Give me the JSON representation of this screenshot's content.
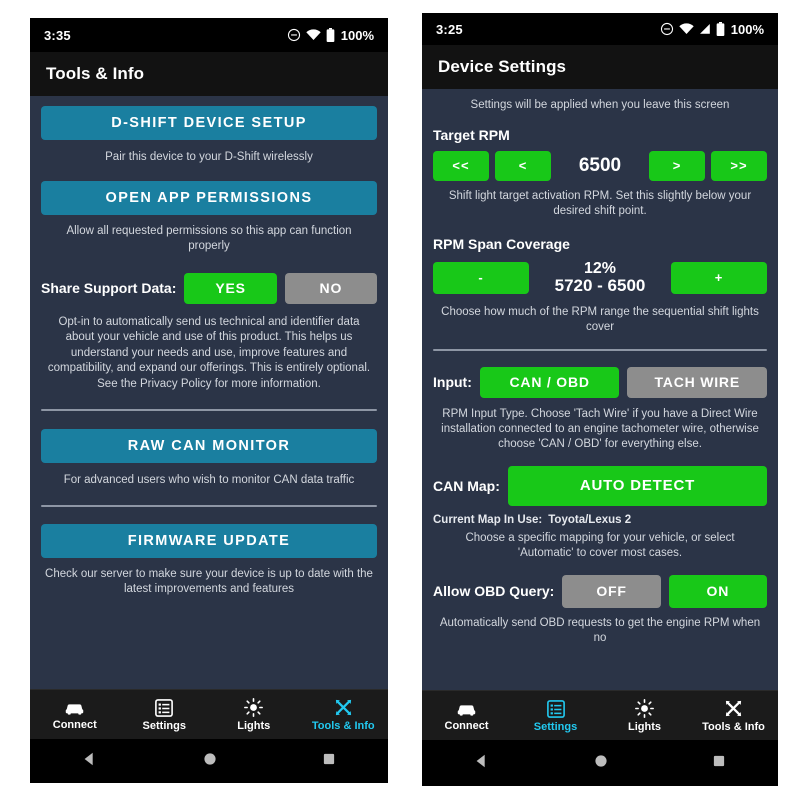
{
  "left_phone": {
    "status_bar": {
      "clock": "3:35",
      "battery_text": "100%",
      "icons": [
        "dnd-icon",
        "wifi-icon",
        "battery-icon"
      ]
    },
    "app_bar": {
      "title": "Tools & Info"
    },
    "sections": {
      "device_setup_button": "D-SHIFT DEVICE SETUP",
      "device_setup_hint": "Pair this device to your D-Shift wirelessly",
      "permissions_button": "OPEN APP PERMISSIONS",
      "permissions_hint": "Allow all requested permissions so this app can function properly",
      "share_support_label": "Share Support Data:",
      "share_support_yes": "YES",
      "share_support_no": "NO",
      "share_support_paragraph": "Opt-in to automatically send us technical and identifier data about your vehicle and use of this product. This helps us understand your needs and use, improve features and compatibility, and expand our offerings. This is entirely optional. See the Privacy Policy for more information.",
      "raw_can_button": "RAW CAN MONITOR",
      "raw_can_hint": "For advanced users who wish to monitor CAN data traffic",
      "firmware_button": "FIRMWARE UPDATE",
      "firmware_hint": "Check our server to make sure your device is up to date with the latest improvements and features"
    },
    "bottom_nav": [
      {
        "label": "Connect",
        "icon": "car-icon",
        "active": false
      },
      {
        "label": "Settings",
        "icon": "list-settings-icon",
        "active": false
      },
      {
        "label": "Lights",
        "icon": "brightness-sun-icon",
        "active": false
      },
      {
        "label": "Tools & Info",
        "icon": "tools-hammer-wrench-icon",
        "active": true
      }
    ]
  },
  "right_phone": {
    "status_bar": {
      "clock": "3:25",
      "battery_text": "100%",
      "icons": [
        "dnd-icon",
        "wifi-icon",
        "cell-signal-icon",
        "battery-icon"
      ]
    },
    "app_bar": {
      "title": "Device Settings"
    },
    "banner": "Settings will be applied when you leave this screen",
    "target_rpm": {
      "label": "Target RPM",
      "fast_down": "<<",
      "down": "<",
      "value": "6500",
      "up": ">",
      "fast_up": ">>",
      "hint": "Shift light target activation RPM. Set this slightly below your desired shift point."
    },
    "rpm_span": {
      "label": "RPM Span Coverage",
      "minus": "-",
      "percent": "12%",
      "range": "5720 - 6500",
      "plus": "+",
      "hint": "Choose how much of the RPM range the sequential shift lights cover"
    },
    "input_type": {
      "label": "Input:",
      "option_can": "CAN / OBD",
      "option_tach": "TACH WIRE",
      "hint": "RPM Input Type. Choose 'Tach Wire' if you have a Direct Wire installation connected to an engine tachometer wire, otherwise choose 'CAN / OBD' for everything else."
    },
    "can_map": {
      "label": "CAN Map:",
      "button": "AUTO DETECT",
      "current_label": "Current Map In Use:",
      "current_value": "Toyota/Lexus 2",
      "hint": "Choose a specific mapping for your vehicle, or select 'Automatic' to cover most cases."
    },
    "obd_query": {
      "label": "Allow OBD Query:",
      "off": "OFF",
      "on": "ON",
      "hint": "Automatically send OBD requests to get the engine RPM when no"
    },
    "bottom_nav": [
      {
        "label": "Connect",
        "icon": "car-icon",
        "active": false
      },
      {
        "label": "Settings",
        "icon": "list-settings-icon",
        "active": true
      },
      {
        "label": "Lights",
        "icon": "brightness-sun-icon",
        "active": false
      },
      {
        "label": "Tools & Info",
        "icon": "tools-hammer-wrench-icon",
        "active": false
      }
    ]
  },
  "colors": {
    "teal": "#1a7fa0",
    "green": "#18c818",
    "gray": "#8d8d8d",
    "screen_bg": "#2b3447",
    "appbar_bg": "#121212",
    "accent_active": "#22c9f0"
  }
}
